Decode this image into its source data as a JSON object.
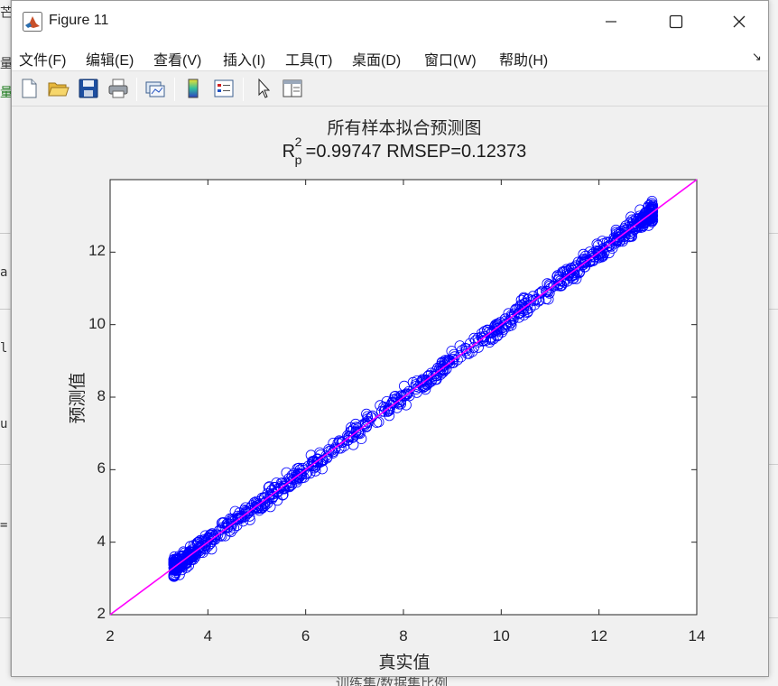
{
  "window": {
    "title": "Figure 11",
    "controls": {
      "minimize": "minimize",
      "maximize": "maximize",
      "close": "close"
    }
  },
  "menu": [
    "文件(F)",
    "编辑(E)",
    "查看(V)",
    "插入(I)",
    "工具(T)",
    "桌面(D)",
    "窗口(W)",
    "帮助(H)"
  ],
  "toolbar": {
    "buttons": [
      "new-figure-icon",
      "open-folder-icon",
      "save-icon",
      "print-icon",
      "link-plot-icon",
      "colorbar-icon",
      "legend-icon",
      "pointer-icon",
      "property-editor-icon"
    ]
  },
  "background": {
    "left_fragments": [
      "芒",
      "量",
      "量",
      "a",
      "l",
      "u",
      "="
    ],
    "bottom_text": "训练集/数据集比例"
  },
  "chart_data": {
    "type": "scatter",
    "title": "所有样本拟合预测图",
    "subtitle": {
      "r_symbol": "R",
      "r_sup": "2",
      "r_sub": "p",
      "text": "=0.99747  RMSEP=0.12373"
    },
    "xlabel": "真实值",
    "ylabel": "预测值",
    "xlim": [
      2,
      14
    ],
    "ylim": [
      2,
      14
    ],
    "xticks": [
      "2",
      "4",
      "6",
      "8",
      "10",
      "12",
      "14"
    ],
    "yticks": [
      "2",
      "4",
      "6",
      "8",
      "10",
      "12"
    ],
    "grid": false,
    "marker": "circle",
    "marker_color": "#0000ff",
    "fit_line": {
      "x": [
        2,
        14
      ],
      "y": [
        2,
        14
      ],
      "color": "#ff00ff"
    },
    "sample_range": {
      "x_min": 3.3,
      "x_max": 13.1,
      "count_estimate": 900
    },
    "r2": 0.99747,
    "rmsep": 0.12373
  }
}
